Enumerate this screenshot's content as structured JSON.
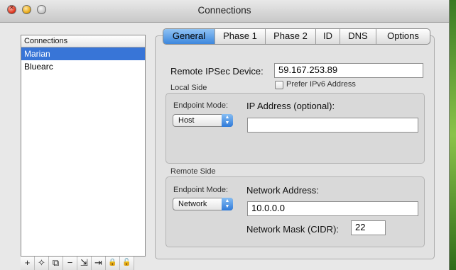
{
  "window": {
    "title": "Connections"
  },
  "connections": {
    "header": "Connections",
    "items": [
      {
        "label": "Marian",
        "selected": true
      },
      {
        "label": "Bluearc",
        "selected": false
      }
    ]
  },
  "toolbar": {
    "add": "+",
    "wizard": "✧",
    "duplicate": "⧉",
    "remove": "−",
    "import": "⇲",
    "export": "⇥",
    "lock": "🔒",
    "unlock": "🔓"
  },
  "tabs": [
    "General",
    "Phase 1",
    "Phase 2",
    "ID",
    "DNS",
    "Options"
  ],
  "active_tab": "General",
  "general": {
    "remote_device_label": "Remote IPSec Device:",
    "remote_device_value": "59.167.253.89",
    "prefer_ipv6_label": "Prefer IPv6 Address",
    "prefer_ipv6_checked": false,
    "local_side": {
      "title": "Local Side",
      "endpoint_mode_label": "Endpoint Mode:",
      "endpoint_mode_value": "Host",
      "ip_address_label": "IP Address (optional):",
      "ip_address_value": ""
    },
    "remote_side": {
      "title": "Remote Side",
      "endpoint_mode_label": "Endpoint Mode:",
      "endpoint_mode_value": "Network",
      "network_address_label": "Network Address:",
      "network_address_value": "10.0.0.0",
      "network_mask_label": "Network Mask (CIDR):",
      "network_mask_value": "22"
    }
  },
  "colors": {
    "selection": "#3875d7",
    "accent": "#3d87dd"
  }
}
